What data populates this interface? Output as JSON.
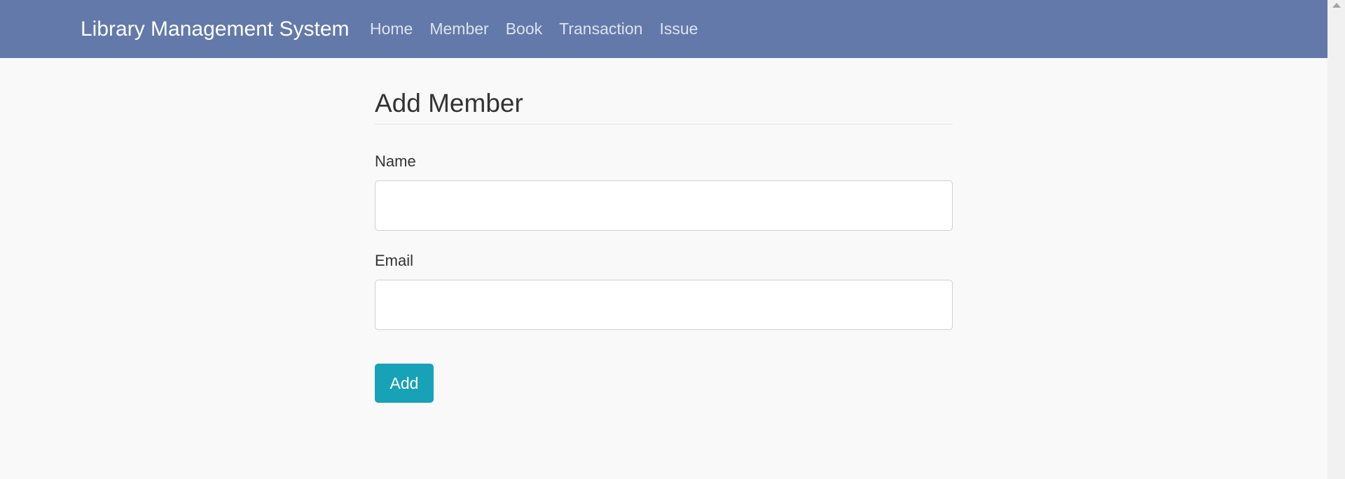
{
  "navbar": {
    "brand": "Library Management System",
    "links": [
      "Home",
      "Member",
      "Book",
      "Transaction",
      "Issue"
    ]
  },
  "form": {
    "title": "Add Member",
    "name_label": "Name",
    "name_value": "",
    "email_label": "Email",
    "email_value": "",
    "submit_label": "Add"
  },
  "colors": {
    "navbar_bg": "#6379aa",
    "button_bg": "#17a2b8"
  },
  "icons": {
    "scroll_up": "scroll-up-arrow-icon"
  }
}
